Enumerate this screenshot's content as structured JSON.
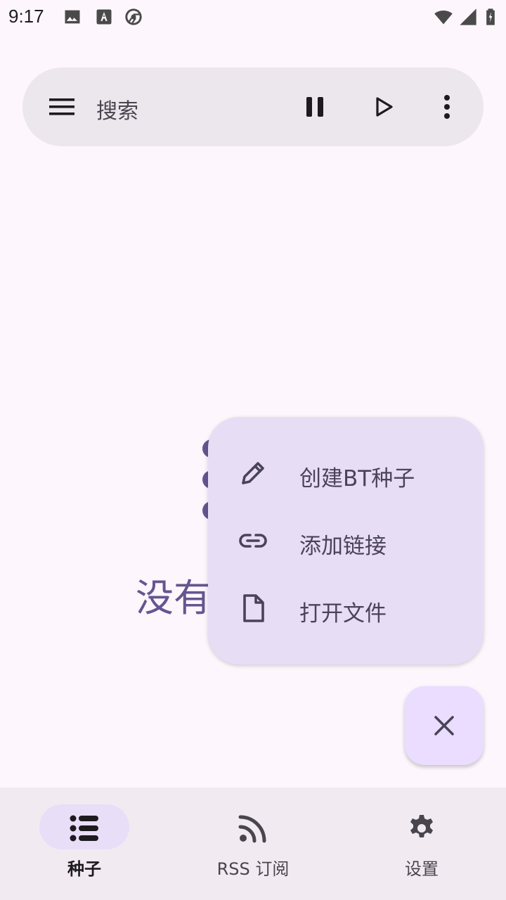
{
  "status_bar": {
    "time": "9:17"
  },
  "search": {
    "label": "搜索"
  },
  "empty_state": {
    "text": "没有"
  },
  "fab_menu": {
    "items": [
      {
        "label": "创建BT种子",
        "icon": "pencil-icon"
      },
      {
        "label": "添加链接",
        "icon": "link-icon"
      },
      {
        "label": "打开文件",
        "icon": "file-icon"
      }
    ]
  },
  "bottom_nav": {
    "items": [
      {
        "label": "种子",
        "icon": "list-icon",
        "active": true
      },
      {
        "label": "RSS 订阅",
        "icon": "rss-icon",
        "active": false
      },
      {
        "label": "设置",
        "icon": "gear-icon",
        "active": false
      }
    ]
  },
  "colors": {
    "accent": "#65558f",
    "background": "#fdf7fd",
    "fab": "#eaddff",
    "menu": "#e7ddf5"
  }
}
